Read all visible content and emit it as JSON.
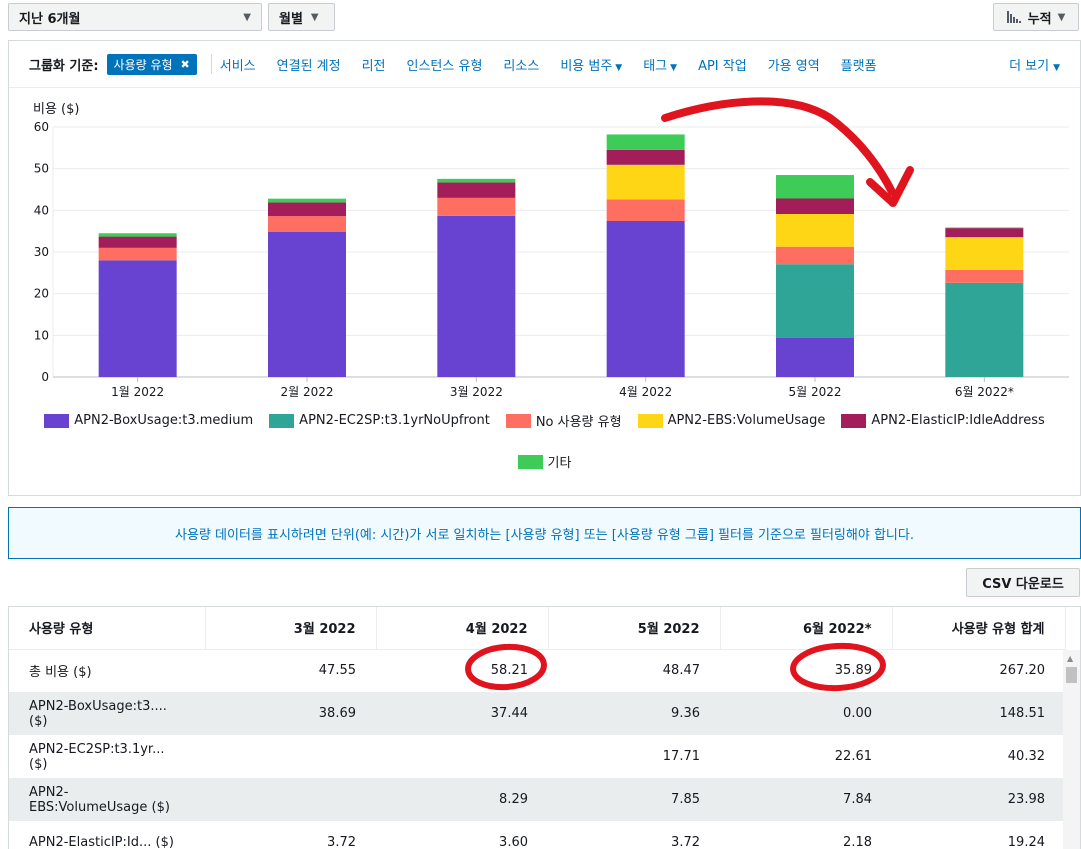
{
  "toolbar": {
    "range_label": "지난 6개월",
    "granularity_label": "월별",
    "chart_type_label": "누적"
  },
  "group_bar": {
    "label": "그룹화 기준:",
    "selected": "사용량 유형",
    "options": [
      "서비스",
      "연결된 계정",
      "리전",
      "인스턴스 유형",
      "리소스",
      "비용 범주",
      "태그",
      "API 작업",
      "가용 영역",
      "플랫폼"
    ],
    "more": "더 보기"
  },
  "chart_data": {
    "type": "bar",
    "stacked": true,
    "ylabel": "비용 ($)",
    "ylim": [
      0,
      60
    ],
    "yticks": [
      0,
      10,
      20,
      30,
      40,
      50,
      60
    ],
    "grid": true,
    "legend_position": "bottom",
    "categories": [
      "1월 2022",
      "2월 2022",
      "3월 2022",
      "4월 2022",
      "5월 2022",
      "6월 2022*"
    ],
    "series": [
      {
        "name": "APN2-BoxUsage:t3.medium",
        "color": "#6842d0",
        "values": [
          28.0,
          34.8,
          38.69,
          37.44,
          9.36,
          0.0
        ]
      },
      {
        "name": "APN2-EC2SP:t3.1yrNoUpfront",
        "color": "#2ea597",
        "values": [
          0,
          0,
          0,
          0,
          17.71,
          22.61
        ]
      },
      {
        "name": "No 사용량 유형",
        "color": "#ff6f61",
        "values": [
          3.0,
          3.8,
          4.3,
          5.2,
          4.2,
          3.1
        ]
      },
      {
        "name": "APN2-EBS:VolumeUsage",
        "color": "#ffd616",
        "values": [
          0,
          0,
          0,
          8.29,
          7.85,
          7.84
        ]
      },
      {
        "name": "APN2-ElasticIP:IdleAddress",
        "color": "#a21d5a",
        "values": [
          2.7,
          3.3,
          3.72,
          3.6,
          3.72,
          2.18
        ]
      },
      {
        "name": "기타",
        "color": "#3ccc57",
        "values": [
          0.8,
          0.9,
          0.84,
          3.68,
          5.63,
          0.16
        ]
      }
    ]
  },
  "banner": {
    "text": "사용량 데이터를 표시하려면 단위(예: 시간)가 서로 일치하는 [사용량 유형] 또는 [사용량 유형 그룹] 필터를 기준으로 필터링해야 합니다."
  },
  "csv_button": "CSV 다운로드",
  "table": {
    "headers": [
      "사용량 유형",
      "3월 2022",
      "4월 2022",
      "5월 2022",
      "6월 2022*",
      "사용량 유형 합계"
    ],
    "rows": [
      [
        "총 비용 ($)",
        "47.55",
        "58.21",
        "48.47",
        "35.89",
        "267.20"
      ],
      [
        "APN2-BoxUsage:t3.... ($)",
        "38.69",
        "37.44",
        "9.36",
        "0.00",
        "148.51"
      ],
      [
        "APN2-EC2SP:t3.1yr... ($)",
        "",
        "",
        "17.71",
        "22.61",
        "40.32"
      ],
      [
        "APN2-EBS:VolumeUsage ($)",
        "",
        "8.29",
        "7.85",
        "7.84",
        "23.98"
      ],
      [
        "APN2-ElasticIP:Id... ($)",
        "3.72",
        "3.60",
        "3.72",
        "2.18",
        "19.24"
      ]
    ]
  },
  "colors": {
    "accent": "#0073bb",
    "annotation": "#e0141e"
  }
}
